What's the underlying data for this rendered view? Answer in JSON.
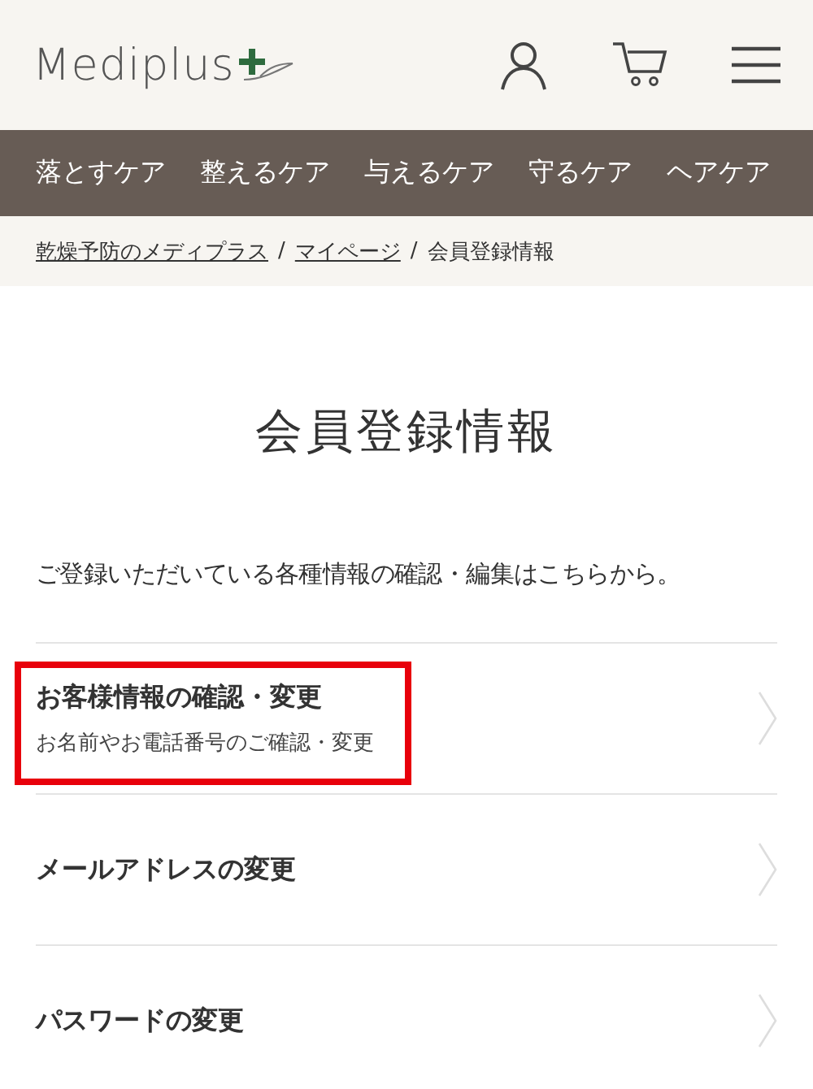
{
  "header": {
    "logo": "Mediplus"
  },
  "nav": [
    {
      "label": "落とすケア"
    },
    {
      "label": "整えるケア"
    },
    {
      "label": "与えるケア"
    },
    {
      "label": "守るケア"
    },
    {
      "label": "ヘアケア"
    }
  ],
  "breadcrumb": [
    {
      "label": "乾燥予防のメディプラス",
      "kind": "link"
    },
    {
      "label": "/",
      "kind": "sep"
    },
    {
      "label": "マイページ",
      "kind": "link"
    },
    {
      "label": "/",
      "kind": "sep"
    },
    {
      "label": "会員登録情報",
      "kind": "current"
    }
  ],
  "page_title": "会員登録情報",
  "intro": "ご登録いただいている各種情報の確認・編集はこちらから。",
  "menu": [
    {
      "title": "お客様情報の確認・変更",
      "subtitle": "お名前やお電話番号のご確認・変更",
      "highlighted": true
    },
    {
      "title": "メールアドレスの変更",
      "highlighted": false
    },
    {
      "title": "パスワードの変更",
      "highlighted": false
    }
  ]
}
